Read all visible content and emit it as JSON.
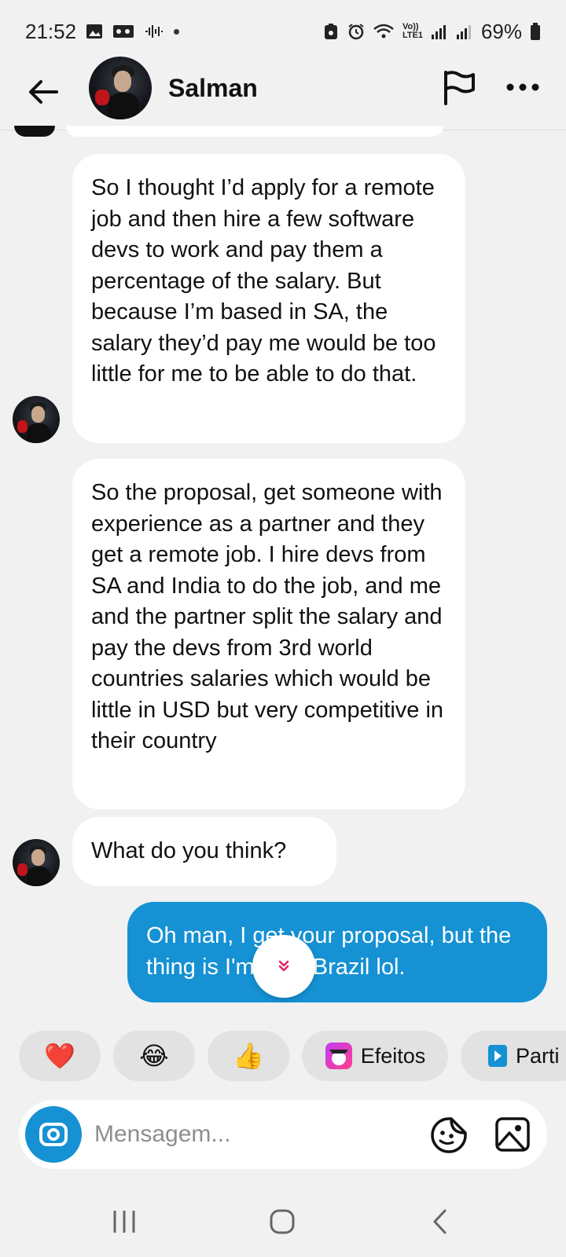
{
  "status_bar": {
    "time": "21:52",
    "battery": "69%",
    "net_label": "Vo)) LTE1"
  },
  "header": {
    "contact_name": "Salman"
  },
  "messages": [
    {
      "sender": "them",
      "text": "So I thought I’d apply for a remote job and then hire a few software devs to work and pay them a percentage of the salary. But because I’m based in SA, the salary they’d pay me would be too little for me to be able to do that."
    },
    {
      "sender": "them",
      "text": "So the proposal, get someone with experience as a partner and they get a remote job. I hire devs from SA and India to do the job, and me and the partner split the salary and pay the devs from 3rd world countries salaries which would be little in USD but very competitive in their country"
    },
    {
      "sender": "them",
      "text": "What do you think?"
    },
    {
      "sender": "me",
      "text": "Oh man, I get your proposal, but the thing is I'm from Brazil lol."
    }
  ],
  "quick_replies": {
    "heart": "❤️",
    "laugh": "😂",
    "thumbs": "👍",
    "effects_label": "Efeitos",
    "partial_label": "Parti"
  },
  "composer": {
    "placeholder": "Mensagem..."
  },
  "colors": {
    "accent": "#1591d4",
    "background": "#f1f1f1",
    "bubble_them": "#ffffff",
    "chip": "#e2e2e2"
  }
}
